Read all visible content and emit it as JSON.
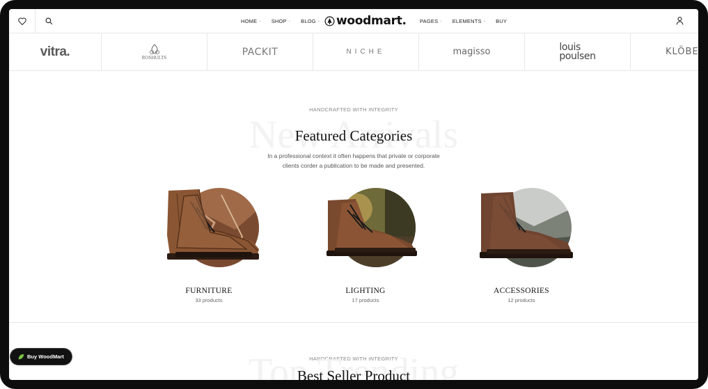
{
  "header": {
    "nav_left": [
      "HOME",
      "SHOP",
      "BLOG"
    ],
    "nav_right": [
      "PAGES",
      "ELEMENTS",
      "BUY"
    ],
    "logo_text": "woodmart."
  },
  "brands": [
    "vitra.",
    "ROSHULTS",
    "PACKIT",
    "NICHE",
    "magisso",
    "louis",
    "poulsen",
    "KLÖBER"
  ],
  "featured": {
    "eyebrow": "HANDCRAFTED WITH INTEGRITY",
    "ghost": "New Arrivals",
    "title": "Featured Categories",
    "subtitle_line1": "In a professional context it often happens that private or corporate",
    "subtitle_line2": "clients corder a publication to be made and presented."
  },
  "categories": [
    {
      "name": "FURNITURE",
      "count": "33 products"
    },
    {
      "name": "LIGHTING",
      "count": "17 products"
    },
    {
      "name": "ACCESSORIES",
      "count": "12 products"
    }
  ],
  "trending": {
    "eyebrow": "HANDCRAFTED WITH INTEGRITY",
    "ghost": "Top Trending",
    "title": "Best Seller Product"
  },
  "buy_button": {
    "label": "Buy WoodMart"
  },
  "colors": {
    "frame": "#0d0d0d",
    "accent_leaf": "#7bc043",
    "boot_brown": "#8a5532"
  },
  "icons": [
    "heart-icon",
    "search-icon",
    "user-icon",
    "tree-logo-icon",
    "leaf-icon"
  ]
}
